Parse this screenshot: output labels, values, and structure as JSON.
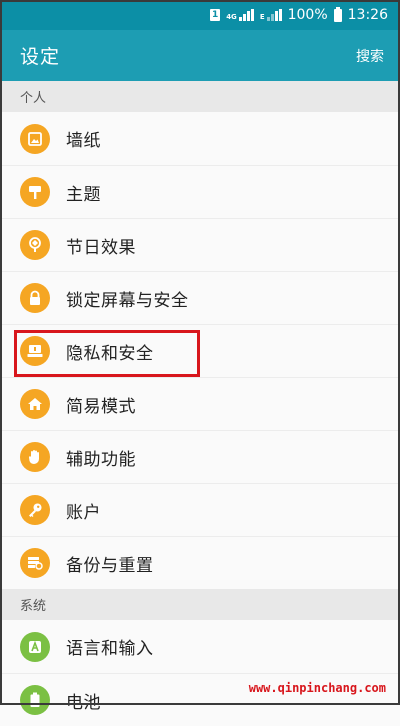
{
  "status_bar": {
    "sim_label": "1",
    "network_tag": "4G",
    "network_tag2": "E",
    "battery": "100%",
    "time": "13:26"
  },
  "toolbar": {
    "title": "设定",
    "search_label": "搜索"
  },
  "sections": {
    "personal": {
      "header": "个人",
      "items": [
        {
          "label": "墙纸",
          "icon": "wallpaper-icon"
        },
        {
          "label": "主题",
          "icon": "theme-icon"
        },
        {
          "label": "节日效果",
          "icon": "festival-effect-icon"
        },
        {
          "label": "锁定屏幕与安全",
          "icon": "lock-icon"
        },
        {
          "label": "隐私和安全",
          "icon": "privacy-icon"
        },
        {
          "label": "简易模式",
          "icon": "easy-mode-icon"
        },
        {
          "label": "辅助功能",
          "icon": "hand-icon"
        },
        {
          "label": "账户",
          "icon": "key-icon"
        },
        {
          "label": "备份与重置",
          "icon": "backup-icon"
        }
      ]
    },
    "system": {
      "header": "系统",
      "items": [
        {
          "label": "语言和输入",
          "icon": "language-icon"
        },
        {
          "label": "电池",
          "icon": "battery-icon"
        }
      ]
    }
  },
  "watermark": "www.qinpinchang.com",
  "colors": {
    "status_bar": "#0c8fa6",
    "toolbar": "#1d9db3",
    "icon_orange": "#f5a623",
    "icon_green": "#7bc043",
    "highlight": "#d8161c"
  }
}
